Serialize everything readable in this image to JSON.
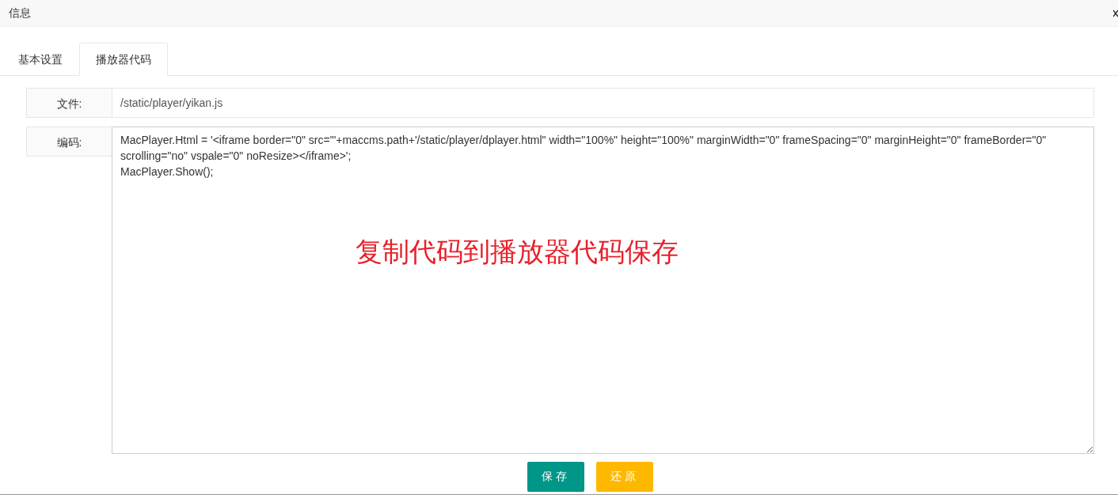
{
  "window": {
    "title": "信息"
  },
  "tabs": [
    {
      "label": "基本设置",
      "selected": false
    },
    {
      "label": "播放器代码",
      "selected": true
    }
  ],
  "file_field": {
    "label": "文件:",
    "value": "/static/player/yikan.js"
  },
  "code_field": {
    "label": "编码:",
    "value": "MacPlayer.Html = '<iframe border=\"0\" src=\"'+maccms.path+'/static/player/dplayer.html\" width=\"100%\" height=\"100%\" marginWidth=\"0\" frameSpacing=\"0\" marginHeight=\"0\" frameBorder=\"0\" scrolling=\"no\" vspale=\"0\" noResize></iframe>';\nMacPlayer.Show();"
  },
  "annotation": "复制代码到播放器代码保存",
  "buttons": [
    {
      "label": "保存",
      "kind": "primary"
    },
    {
      "label": "还原",
      "kind": "warning"
    }
  ]
}
